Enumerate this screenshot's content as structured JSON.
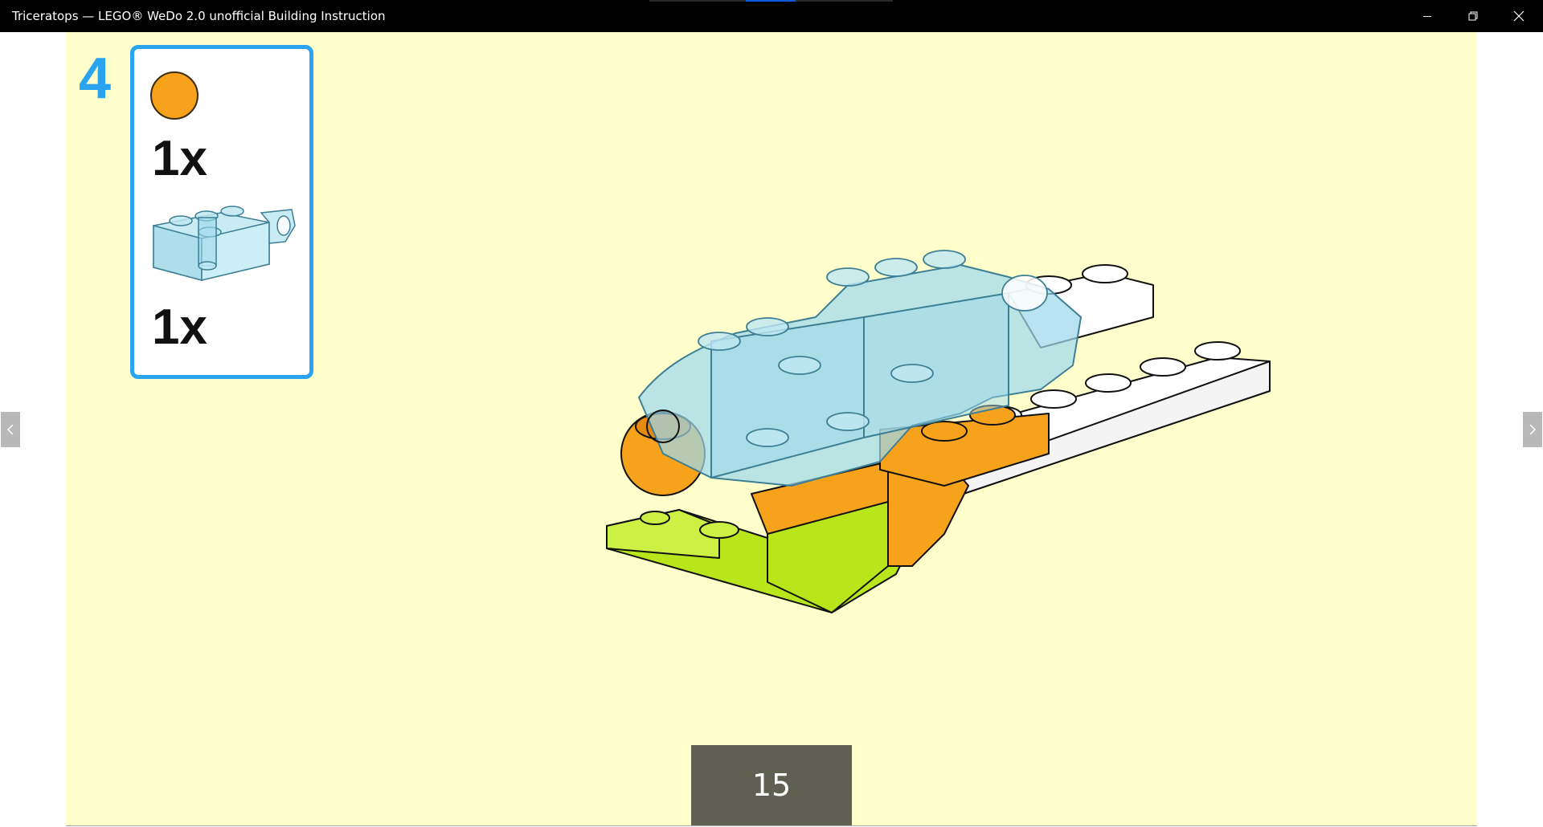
{
  "window": {
    "title": "Triceratops — LEGO® WeDo 2.0 unofficial Building Instruction",
    "controls": [
      "minimize",
      "maximize",
      "close"
    ]
  },
  "instruction": {
    "step_number": "4",
    "parts": [
      {
        "icon": "orange-round-piece-icon",
        "color": "#f7a21b",
        "quantity": "1x"
      },
      {
        "icon": "transparent-light-blue-brick-icon",
        "color": "#9fd8ec",
        "quantity": "1x"
      }
    ],
    "accent_color": "#2aa3f0",
    "background_color": "#ffffcc"
  },
  "navigation": {
    "prev_icon": "chevron-left-icon",
    "next_icon": "chevron-right-icon"
  },
  "page_number": "15"
}
